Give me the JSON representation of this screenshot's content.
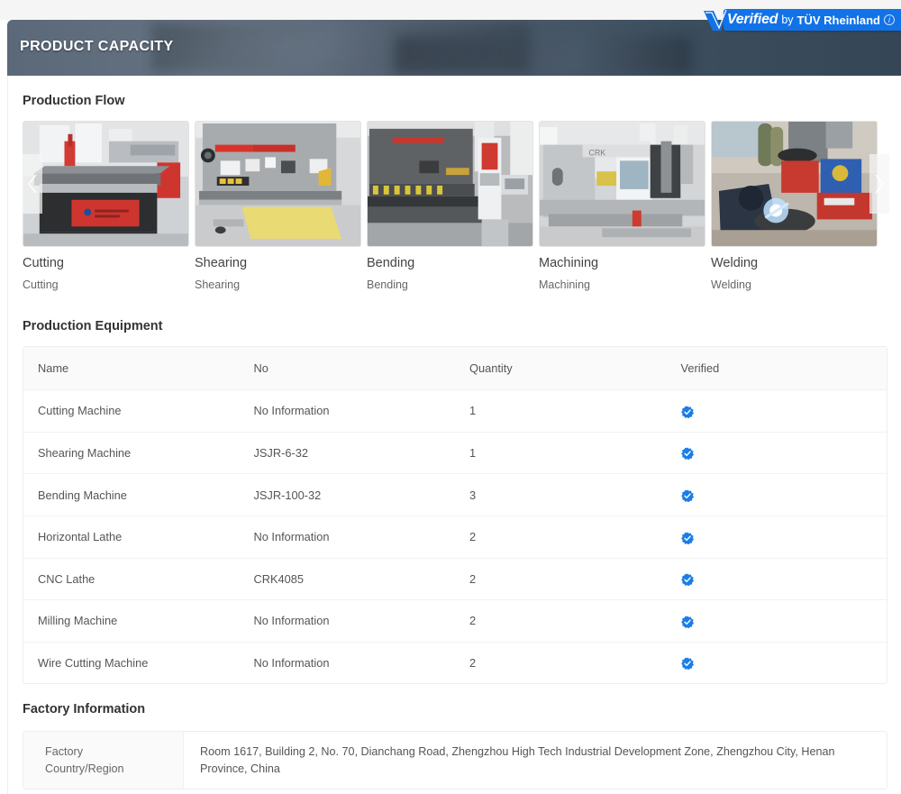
{
  "banner": {
    "title": "PRODUCT CAPACITY"
  },
  "verified_badge": {
    "verified_label": "Verified",
    "by_label": "by",
    "org_label": "TÜV Rheinland",
    "info_icon": "info-icon",
    "check_icon": "check-icon",
    "accent_color": "#1272e8"
  },
  "production_flow": {
    "title": "Production Flow",
    "prev_label": "‹",
    "next_label": "›",
    "items": [
      {
        "name": "Cutting",
        "desc": "Cutting",
        "image_alt": "cnc-plasma-cutting-table"
      },
      {
        "name": "Shearing",
        "desc": "Shearing",
        "image_alt": "hydraulic-shearing-machine"
      },
      {
        "name": "Bending",
        "desc": "Bending",
        "image_alt": "press-brake-bending-machine"
      },
      {
        "name": "Machining",
        "desc": "Machining",
        "image_alt": "cnc-lathe-machining-center"
      },
      {
        "name": "Welding",
        "desc": "Welding",
        "image_alt": "worker-arc-welding"
      }
    ]
  },
  "production_equipment": {
    "title": "Production Equipment",
    "columns": [
      "Name",
      "No",
      "Quantity",
      "Verified"
    ],
    "rows": [
      {
        "name": "Cutting Machine",
        "no": "No Information",
        "quantity": "1",
        "verified": true
      },
      {
        "name": "Shearing Machine",
        "no": "JSJR-6-32",
        "quantity": "1",
        "verified": true
      },
      {
        "name": "Bending Machine",
        "no": "JSJR-100-32",
        "quantity": "3",
        "verified": true
      },
      {
        "name": "Horizontal Lathe",
        "no": "No Information",
        "quantity": "2",
        "verified": true
      },
      {
        "name": "CNC Lathe",
        "no": "CRK4085",
        "quantity": "2",
        "verified": true
      },
      {
        "name": "Milling Machine",
        "no": "No Information",
        "quantity": "2",
        "verified": true
      },
      {
        "name": "Wire Cutting Machine",
        "no": "No Information",
        "quantity": "2",
        "verified": true
      }
    ],
    "verified_icon_color": "#1a7ee8"
  },
  "factory_information": {
    "title": "Factory Information",
    "label_line1": "Factory",
    "label_line2": "Country/Region",
    "value": "Room 1617, Building 2, No. 70, Dianchang Road, Zhengzhou High Tech Industrial Development Zone, Zhengzhou City, Henan Province, China"
  }
}
